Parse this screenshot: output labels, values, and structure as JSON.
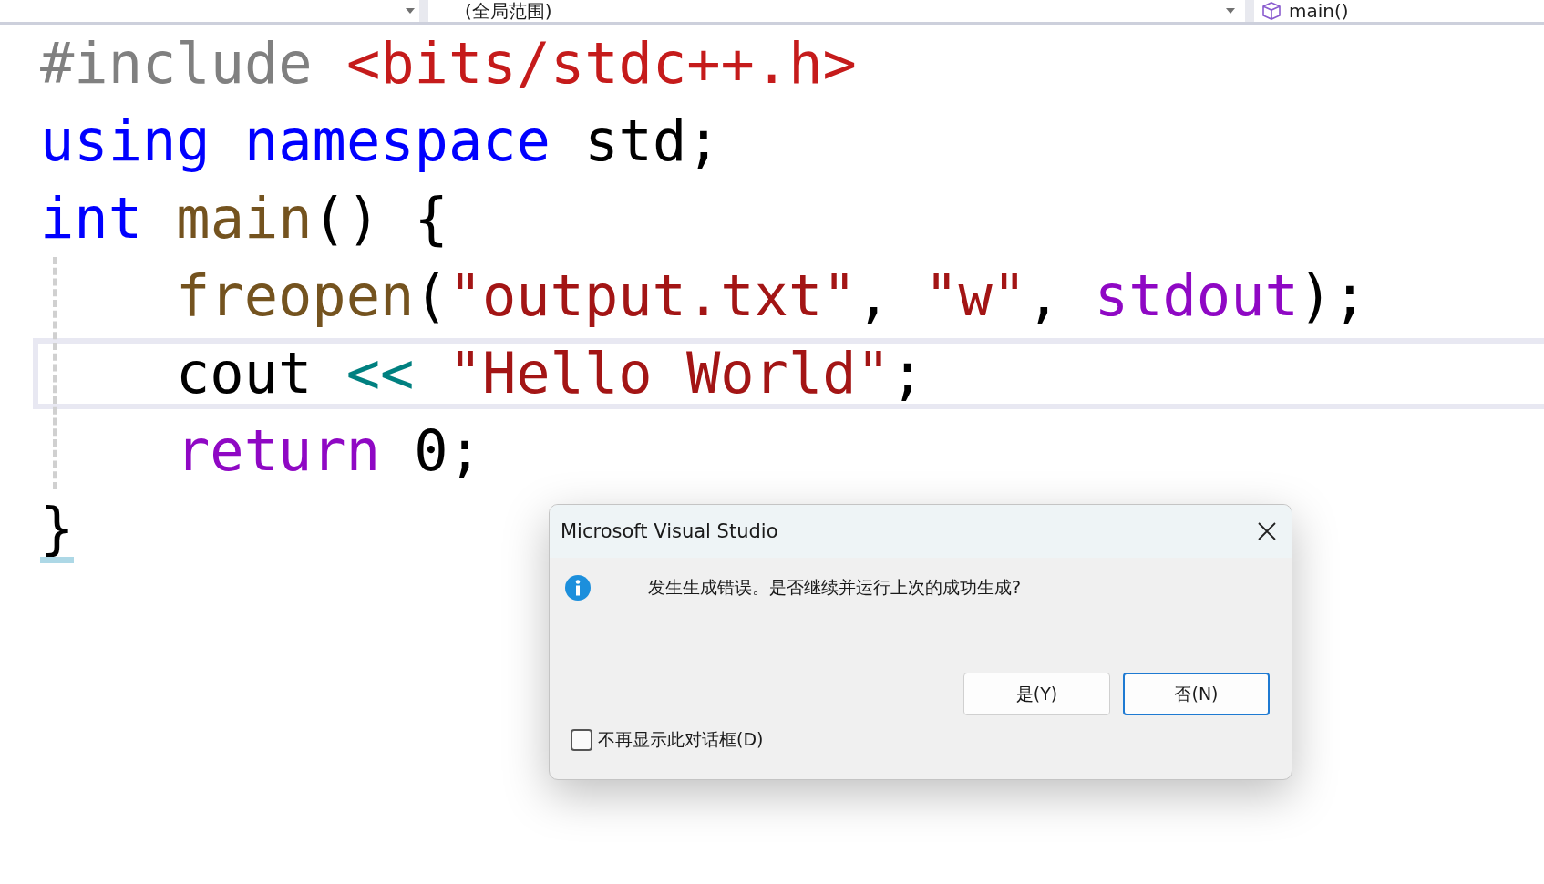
{
  "navigation_bar": {
    "dropdowns": [
      {
        "label": "(全局范围)",
        "kind": "scope"
      },
      {
        "label": "main()",
        "kind": "member"
      }
    ]
  },
  "code": {
    "lines": [
      {
        "current": false,
        "brace_match": false,
        "tokens": [
          {
            "kind": "preproc",
            "text": "#include "
          },
          {
            "kind": "include",
            "text": "<bits/stdc++.h>"
          }
        ]
      },
      {
        "current": false,
        "brace_match": false,
        "tokens": [
          {
            "kind": "keyword",
            "text": "using namespace "
          },
          {
            "kind": "plain",
            "text": "std;"
          }
        ]
      },
      {
        "current": false,
        "brace_match": false,
        "tokens": [
          {
            "kind": "keyword",
            "text": "int "
          },
          {
            "kind": "func",
            "text": "main"
          },
          {
            "kind": "plain",
            "text": "() {"
          }
        ],
        "children": [
          {
            "current": false,
            "brace_match": false,
            "tokens": [
              {
                "kind": "func",
                "text": "freopen"
              },
              {
                "kind": "plain",
                "text": "("
              },
              {
                "kind": "string",
                "text": "\"output.txt\""
              },
              {
                "kind": "plain",
                "text": ", "
              },
              {
                "kind": "string",
                "text": "\"w\""
              },
              {
                "kind": "plain",
                "text": ", "
              },
              {
                "kind": "macro",
                "text": "stdout"
              },
              {
                "kind": "plain",
                "text": ");"
              }
            ]
          },
          {
            "current": true,
            "brace_match": false,
            "tokens": [
              {
                "kind": "plain",
                "text": "cout "
              },
              {
                "kind": "operator",
                "text": "<< "
              },
              {
                "kind": "string",
                "text": "\"Hello World\""
              },
              {
                "kind": "plain",
                "text": ";"
              }
            ]
          },
          {
            "current": false,
            "brace_match": false,
            "tokens": [
              {
                "kind": "macro",
                "text": "return "
              },
              {
                "kind": "plain",
                "text": "0;"
              }
            ]
          }
        ]
      },
      {
        "current": false,
        "brace_match": true,
        "tokens": [
          {
            "kind": "plain",
            "text": "}"
          }
        ]
      }
    ]
  },
  "dialog": {
    "title": "Microsoft Visual Studio",
    "message": "发生生成错误。是否继续并运行上次的成功生成?",
    "buttons": [
      {
        "label": "是(Y)",
        "selected": false
      },
      {
        "label": "否(N)",
        "selected": true
      }
    ],
    "checkbox": {
      "label": "不再显示此对话框(D)",
      "checked": false
    }
  }
}
